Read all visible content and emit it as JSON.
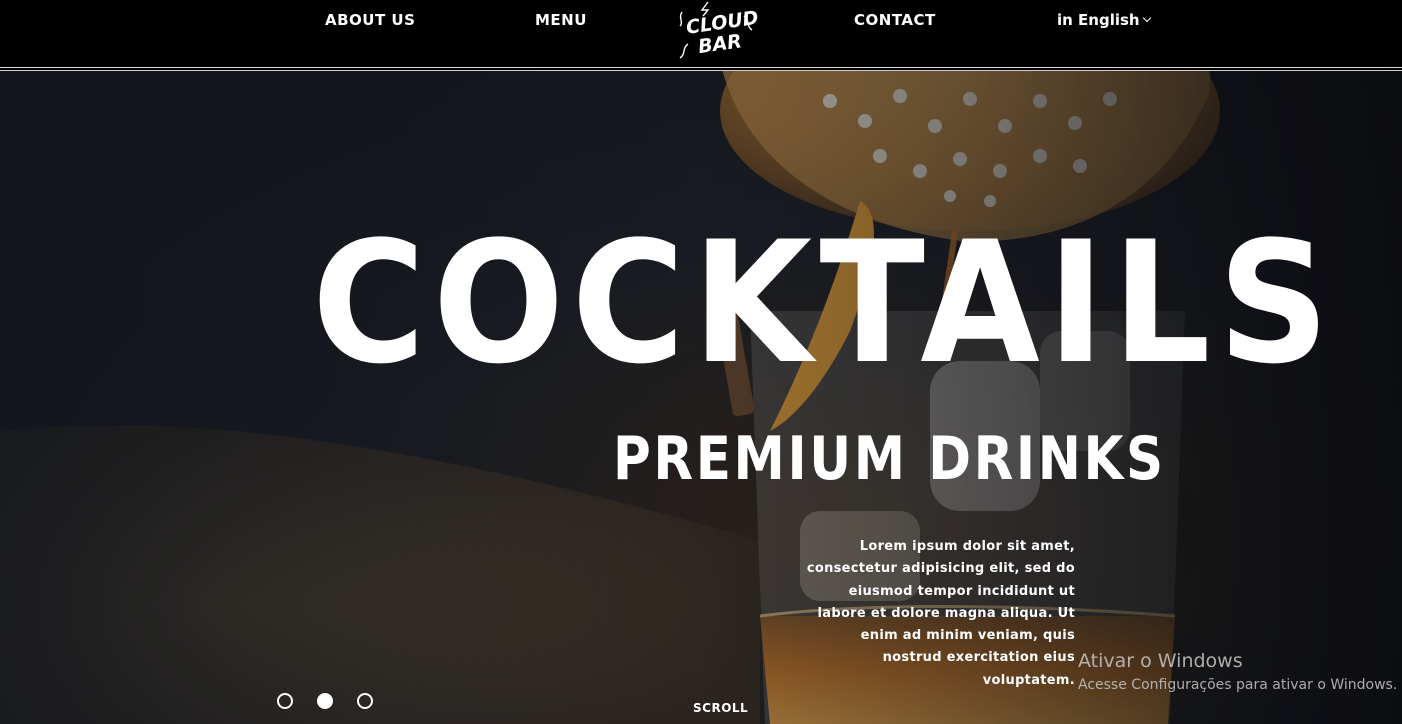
{
  "header": {
    "nav": {
      "about": "ABOUT US",
      "menu": "MENU",
      "contact": "CONTACT",
      "language": "in English"
    },
    "logo": {
      "line1": "CLOUD",
      "line2": "BAR"
    }
  },
  "hero": {
    "title": "COCKTAILS",
    "subtitle": "PREMIUM DRINKS",
    "description": "Lorem ipsum dolor sit amet, consectetur adipisicing elit, sed do eiusmod tempor incididunt ut labore et dolore magna aliqua. Ut enim ad minim veniam, quis nostrud exercitation eius voluptatem.",
    "slider": {
      "count": 3,
      "active_index": 2
    },
    "scroll_label": "SCROLL"
  },
  "system_overlay": {
    "title": "Ativar o Windows",
    "subtitle": "Acesse Configurações para ativar o Windows."
  },
  "colors": {
    "background": "#000000",
    "text": "#ffffff",
    "accent_orange": "#e8a23a",
    "amber_drink": "#c9792a"
  }
}
